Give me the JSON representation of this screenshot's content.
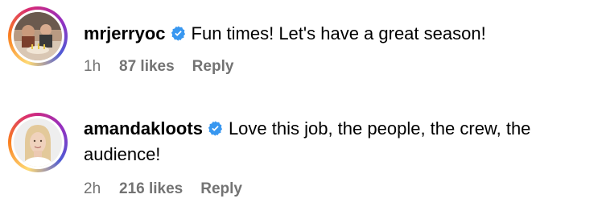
{
  "comments": [
    {
      "username": "mrjerryoc",
      "verified": true,
      "text": "Fun times! Let's have a great season!",
      "time": "1h",
      "likes": "87 likes",
      "reply_label": "Reply",
      "avatar_icon": "avatar-photo-icon"
    },
    {
      "username": "amandakloots",
      "verified": true,
      "text": "Love this job, the people, the crew, the audience!",
      "time": "2h",
      "likes": "216 likes",
      "reply_label": "Reply",
      "avatar_icon": "avatar-photo-icon"
    }
  ],
  "colors": {
    "verified_badge": "#3897f0",
    "meta_text": "#737373",
    "story_ring": [
      "#feda75",
      "#fa7e1e",
      "#d62976",
      "#962fbf",
      "#4f5bd5"
    ]
  }
}
